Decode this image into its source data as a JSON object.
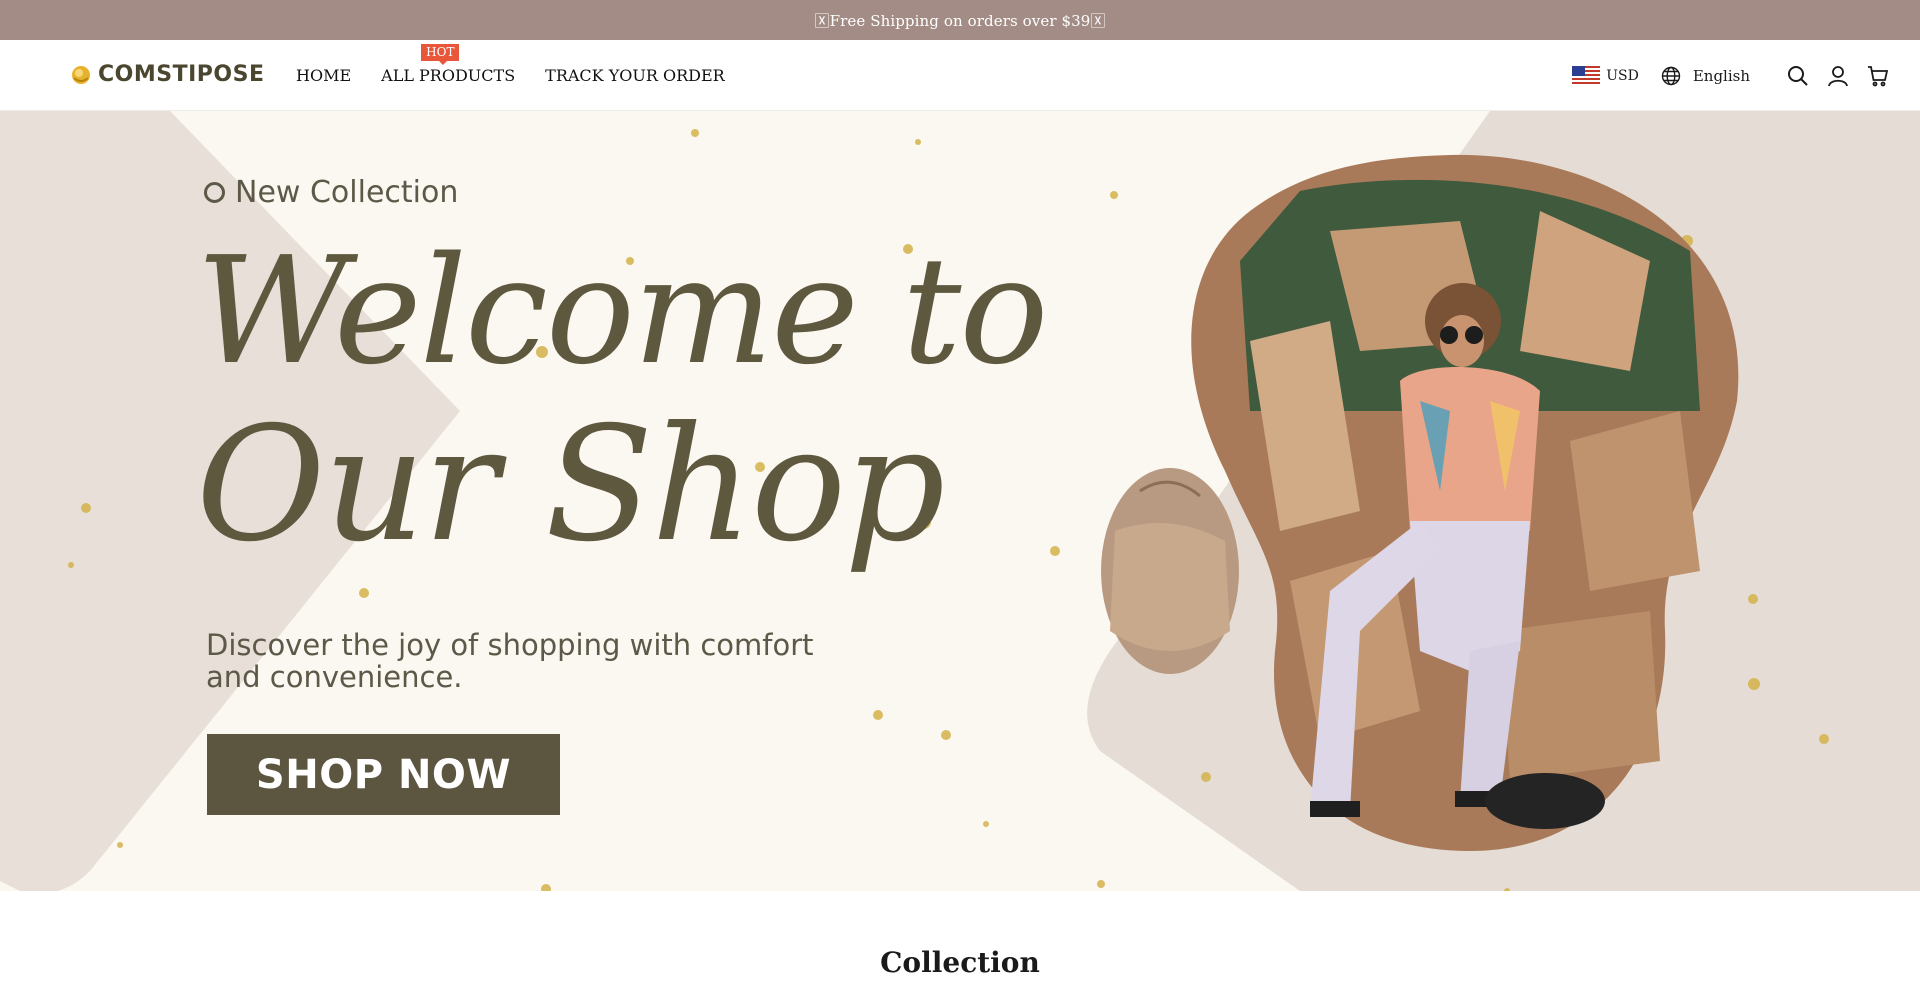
{
  "announcement": {
    "text": "🅇Free Shipping on orders over $39🅇"
  },
  "header": {
    "brand": "COMSTIPOSE",
    "nav": [
      {
        "label": "HOME"
      },
      {
        "label": "ALL PRODUCTS",
        "badge": "HOT"
      },
      {
        "label": "TRACK YOUR ORDER"
      }
    ],
    "currency": "USD",
    "language": "English",
    "icons": [
      "us-flag-icon",
      "globe-icon",
      "search-icon",
      "account-icon",
      "cart-icon"
    ]
  },
  "hero": {
    "eyebrow": "New Collection",
    "headline_line1": "Welcome to",
    "headline_line2": "Our Shop",
    "subtitle": "Discover the joy of shopping with comfort and convenience.",
    "cta": "SHOP NOW"
  },
  "section": {
    "title": "Collection"
  },
  "colors": {
    "announcement_bg": "#a38c85",
    "hero_bg": "#fbf7f1",
    "hero_shape": "#e5ddd5",
    "accent_olive": "#5c5640",
    "hot_badge": "#e8573a"
  }
}
